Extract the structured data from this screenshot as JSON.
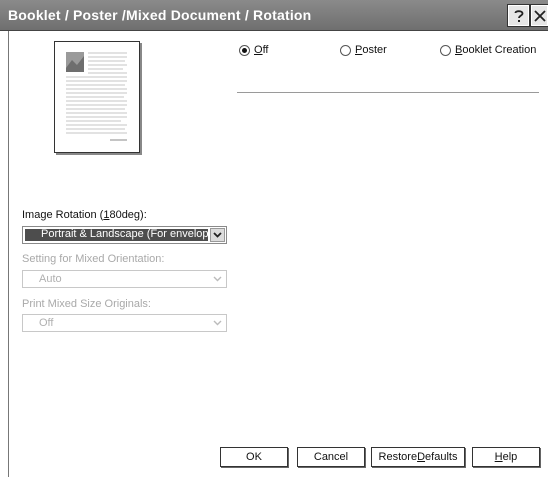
{
  "window": {
    "title": "Booklet / Poster /Mixed Document / Rotation"
  },
  "mode": {
    "options": [
      {
        "label_pre": "",
        "label_u": "O",
        "label_post": "ff",
        "selected": true
      },
      {
        "label_pre": "",
        "label_u": "P",
        "label_post": "oster",
        "selected": false
      },
      {
        "label_pre": "",
        "label_u": "B",
        "label_post": "ooklet Creation",
        "selected": false
      }
    ]
  },
  "image_rotation": {
    "label_pre": "Image Rotation (",
    "label_u": "1",
    "label_post": "80deg):",
    "value": "Portrait & Landscape (For envelopes)"
  },
  "mixed_orientation": {
    "label": "Setting for Mixed Orientation:",
    "value": "Auto"
  },
  "mixed_size": {
    "label": "Print Mixed Size Originals:",
    "value": "Off"
  },
  "buttons": {
    "ok": "OK",
    "cancel": "Cancel",
    "restore_pre": "Restore ",
    "restore_u": "D",
    "restore_post": "efaults",
    "help_u": "H",
    "help_post": "elp"
  }
}
